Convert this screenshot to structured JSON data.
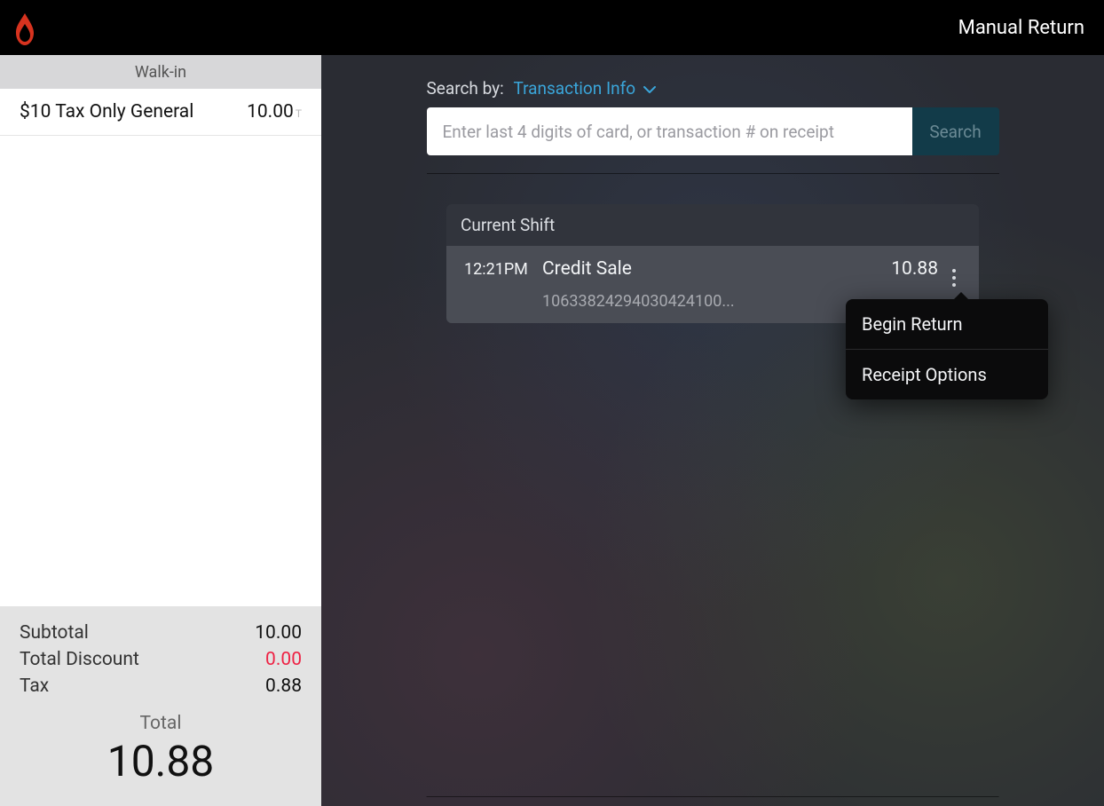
{
  "header": {
    "title": "Manual Return"
  },
  "sidebar": {
    "customer": "Walk-in",
    "items": [
      {
        "name": "$10 Tax Only General",
        "price": "10.00",
        "suffix": "T"
      }
    ],
    "totals": {
      "subtotal_label": "Subtotal",
      "subtotal_value": "10.00",
      "discount_label": "Total Discount",
      "discount_value": "0.00",
      "tax_label": "Tax",
      "tax_value": "0.88",
      "total_label": "Total",
      "total_value": "10.88"
    }
  },
  "main": {
    "search_by_label": "Search by:",
    "search_by_option": "Transaction Info",
    "search_placeholder": "Enter last 4 digits of card, or transaction # on receipt",
    "search_button": "Search",
    "shift_header": "Current Shift",
    "transaction": {
      "time": "12:21PM",
      "type": "Credit Sale",
      "amount": "10.88",
      "id": "10633824294030424100..."
    },
    "popover": {
      "begin_return": "Begin Return",
      "receipt_options": "Receipt Options"
    }
  }
}
